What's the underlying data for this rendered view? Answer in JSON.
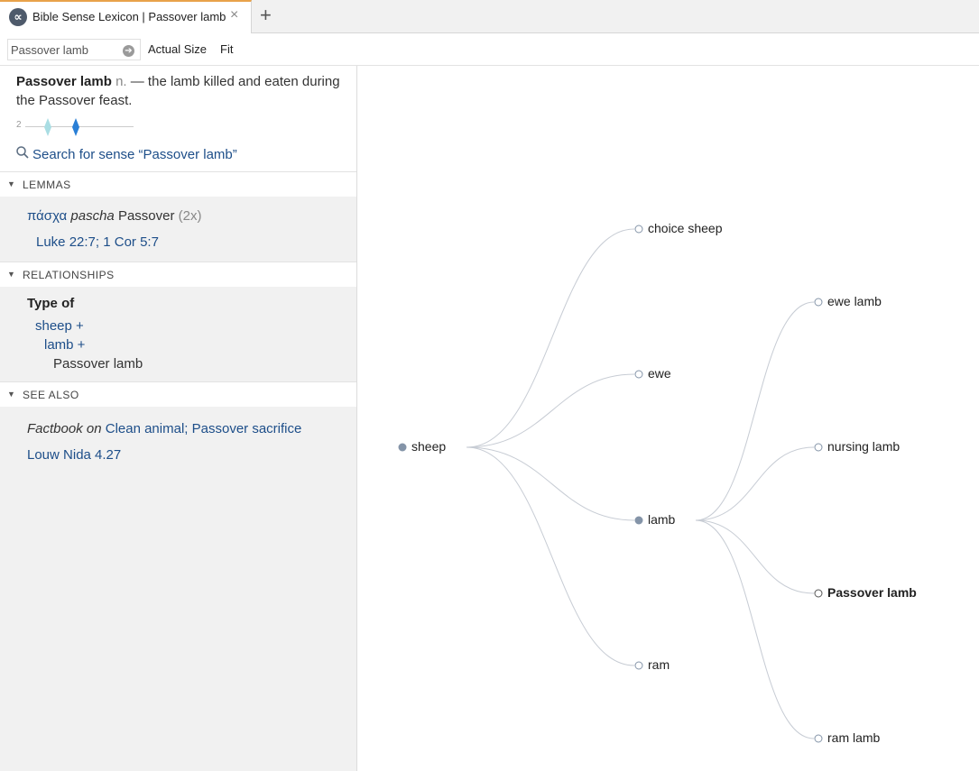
{
  "tab": {
    "title": "Bible Sense Lexicon | Passover lamb",
    "logo_glyph": "∝",
    "close_glyph": "×",
    "add_glyph": "+"
  },
  "toolbar": {
    "search_value": "Passover lamb",
    "go_glyph": "➔",
    "actual_size_label": "Actual Size",
    "fit_label": "Fit"
  },
  "definition": {
    "term": "Passover lamb",
    "pos": "n.",
    "text": "— the lamb killed and eaten during the Passover feast.",
    "slider_value": "2",
    "search_link": "Search for sense “Passover lamb”"
  },
  "sections": {
    "lemmas": {
      "title": "LEMMAS",
      "lemma_greek": "πάσχα",
      "lemma_translit": "pascha",
      "lemma_gloss": "Passover",
      "lemma_count": "(2x)",
      "refs": [
        "Luke 22:7",
        "1 Cor 5:7"
      ],
      "ref_sep": "; "
    },
    "relationships": {
      "title": "RELATIONSHIPS",
      "type_label": "Type of",
      "chain": [
        "sheep +",
        "lamb +",
        "Passover lamb"
      ]
    },
    "see_also": {
      "title": "SEE ALSO",
      "factbook_label": "Factbook",
      "on_word": "on",
      "factbook_links": [
        "Clean animal",
        "Passover sacrifice"
      ],
      "louw_nida": "Louw Nida 4.27"
    }
  },
  "graph": {
    "root": "sheep",
    "children_of_sheep": [
      "choice sheep",
      "ewe",
      "lamb",
      "ram"
    ],
    "children_of_lamb": [
      "ewe lamb",
      "nursing lamb",
      "Passover lamb",
      "ram lamb"
    ],
    "selected": "Passover lamb",
    "colors": {
      "edge": "#c7ccd4",
      "filled_node": "#8494a8",
      "hollow_stroke": "#8494a8",
      "link": "#1d4e89"
    }
  }
}
